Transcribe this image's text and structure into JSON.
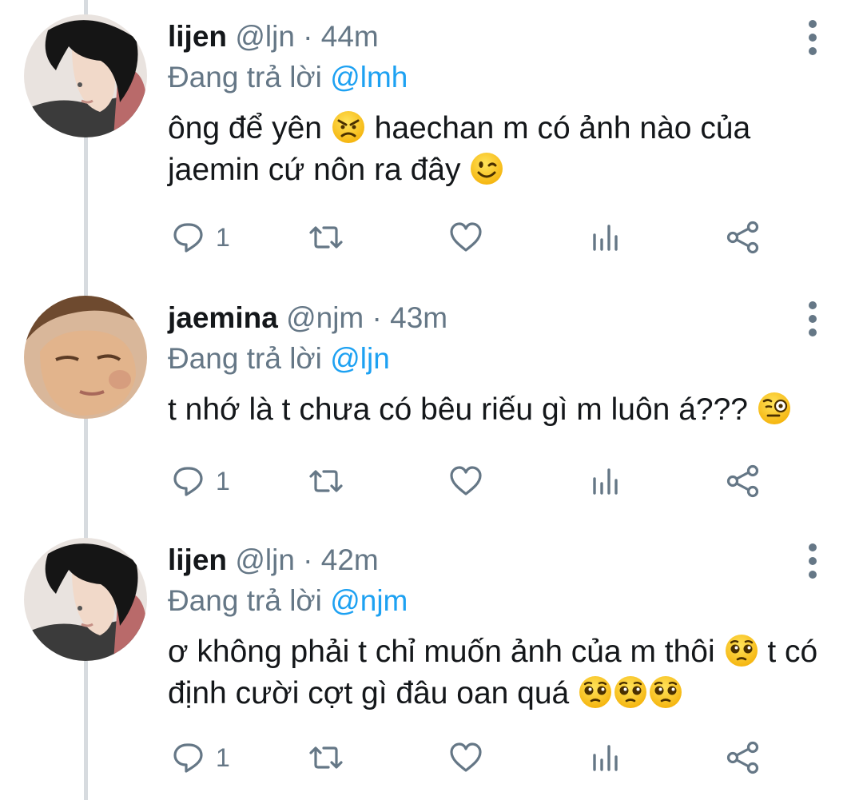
{
  "tweets": [
    {
      "name": "lijen",
      "handle": "@ljn",
      "separator": "·",
      "time": "44m",
      "replying_prefix": "Đang trả lời",
      "replying_to": "@lmh",
      "text_parts": [
        "ông để yên ",
        " haechan m có ảnh nào của jaemin cứ nôn ra đây "
      ],
      "emojis": [
        "angry-face-emoji",
        "winking-face-emoji"
      ],
      "reply_count": "1"
    },
    {
      "name": "jaemina",
      "handle": "@njm",
      "separator": "·",
      "time": "43m",
      "replying_prefix": "Đang trả lời",
      "replying_to": "@ljn",
      "text_parts": [
        "t nhớ là t chưa có bêu riếu gì m luôn á??? "
      ],
      "emojis": [
        "face-with-monocle-emoji"
      ],
      "reply_count": "1"
    },
    {
      "name": "lijen",
      "handle": "@ljn",
      "separator": "·",
      "time": "42m",
      "replying_prefix": "Đang trả lời",
      "replying_to": "@njm",
      "text_parts": [
        "ơ không phải t chỉ muốn ảnh của m thôi ",
        " t có định cười cợt gì đâu oan quá "
      ],
      "emojis": [
        "pleading-face-emoji",
        "pleading-face-emoji",
        "pleading-face-emoji",
        "pleading-face-emoji"
      ],
      "reply_count": "1"
    }
  ],
  "colors": {
    "text": "#14171a",
    "secondary": "#657786",
    "mention": "#1da1f2",
    "thread_line": "#d7dbdf"
  },
  "icons": [
    "reply-icon",
    "retweet-icon",
    "like-icon",
    "analytics-icon",
    "share-icon",
    "more-vertical-icon"
  ]
}
